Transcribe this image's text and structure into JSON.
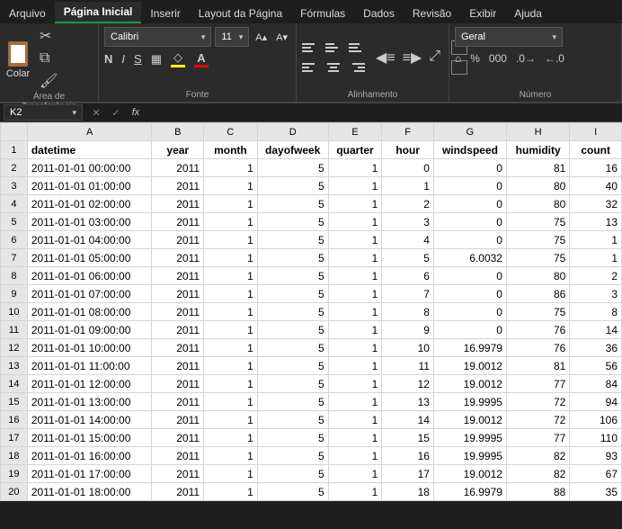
{
  "menu": {
    "arquivo": "Arquivo",
    "pagina_inicial": "Página Inicial",
    "inserir": "Inserir",
    "layout": "Layout da Página",
    "formulas": "Fórmulas",
    "dados": "Dados",
    "revisao": "Revisão",
    "exibir": "Exibir",
    "ajuda": "Ajuda"
  },
  "ribbon": {
    "clipboard_label": "Colar",
    "clipboard_group": "Área de Transferência",
    "font_name": "Calibri",
    "font_size": "11",
    "font_group": "Fonte",
    "align_group": "Alinhamento",
    "number_format": "Geral",
    "number_group": "Número"
  },
  "fx": {
    "namebox": "K2",
    "formula": ""
  },
  "cols": [
    "A",
    "B",
    "C",
    "D",
    "E",
    "F",
    "G",
    "H",
    "I"
  ],
  "headers": [
    "datetime",
    "year",
    "month",
    "dayofweek",
    "quarter",
    "hour",
    "windspeed",
    "humidity",
    "count"
  ],
  "rows": [
    [
      "2011-01-01 00:00:00",
      "2011",
      "1",
      "5",
      "1",
      "0",
      "0",
      "81",
      "16"
    ],
    [
      "2011-01-01 01:00:00",
      "2011",
      "1",
      "5",
      "1",
      "1",
      "0",
      "80",
      "40"
    ],
    [
      "2011-01-01 02:00:00",
      "2011",
      "1",
      "5",
      "1",
      "2",
      "0",
      "80",
      "32"
    ],
    [
      "2011-01-01 03:00:00",
      "2011",
      "1",
      "5",
      "1",
      "3",
      "0",
      "75",
      "13"
    ],
    [
      "2011-01-01 04:00:00",
      "2011",
      "1",
      "5",
      "1",
      "4",
      "0",
      "75",
      "1"
    ],
    [
      "2011-01-01 05:00:00",
      "2011",
      "1",
      "5",
      "1",
      "5",
      "6.0032",
      "75",
      "1"
    ],
    [
      "2011-01-01 06:00:00",
      "2011",
      "1",
      "5",
      "1",
      "6",
      "0",
      "80",
      "2"
    ],
    [
      "2011-01-01 07:00:00",
      "2011",
      "1",
      "5",
      "1",
      "7",
      "0",
      "86",
      "3"
    ],
    [
      "2011-01-01 08:00:00",
      "2011",
      "1",
      "5",
      "1",
      "8",
      "0",
      "75",
      "8"
    ],
    [
      "2011-01-01 09:00:00",
      "2011",
      "1",
      "5",
      "1",
      "9",
      "0",
      "76",
      "14"
    ],
    [
      "2011-01-01 10:00:00",
      "2011",
      "1",
      "5",
      "1",
      "10",
      "16.9979",
      "76",
      "36"
    ],
    [
      "2011-01-01 11:00:00",
      "2011",
      "1",
      "5",
      "1",
      "11",
      "19.0012",
      "81",
      "56"
    ],
    [
      "2011-01-01 12:00:00",
      "2011",
      "1",
      "5",
      "1",
      "12",
      "19.0012",
      "77",
      "84"
    ],
    [
      "2011-01-01 13:00:00",
      "2011",
      "1",
      "5",
      "1",
      "13",
      "19.9995",
      "72",
      "94"
    ],
    [
      "2011-01-01 14:00:00",
      "2011",
      "1",
      "5",
      "1",
      "14",
      "19.0012",
      "72",
      "106"
    ],
    [
      "2011-01-01 15:00:00",
      "2011",
      "1",
      "5",
      "1",
      "15",
      "19.9995",
      "77",
      "110"
    ],
    [
      "2011-01-01 16:00:00",
      "2011",
      "1",
      "5",
      "1",
      "16",
      "19.9995",
      "82",
      "93"
    ],
    [
      "2011-01-01 17:00:00",
      "2011",
      "1",
      "5",
      "1",
      "17",
      "19.0012",
      "82",
      "67"
    ],
    [
      "2011-01-01 18:00:00",
      "2011",
      "1",
      "5",
      "1",
      "18",
      "16.9979",
      "88",
      "35"
    ]
  ]
}
